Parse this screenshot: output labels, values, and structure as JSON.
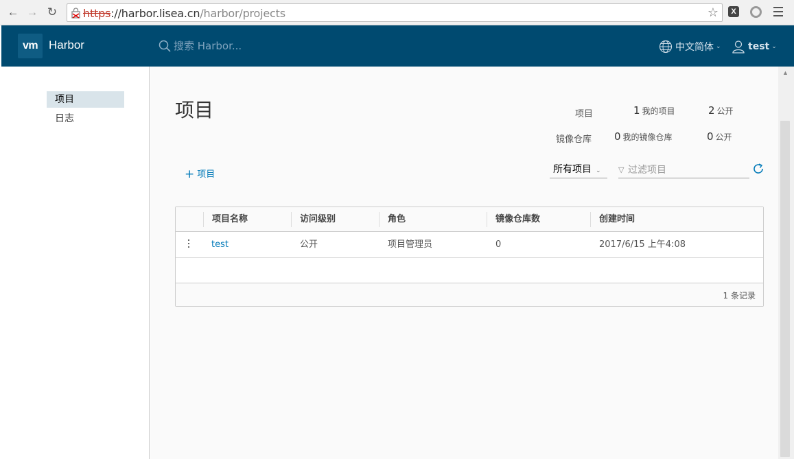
{
  "browser": {
    "url_scheme": "https",
    "url_sep": "://",
    "url_host": "harbor.lisea.cn",
    "url_path": "/harbor/projects"
  },
  "header": {
    "logo": "vm",
    "brand": "Harbor",
    "search_placeholder": "搜索 Harbor...",
    "language": "中文简体",
    "user": "test"
  },
  "sidebar": {
    "items": [
      {
        "label": "项目",
        "active": true
      },
      {
        "label": "日志",
        "active": false
      }
    ]
  },
  "main": {
    "title": "项目",
    "stats": {
      "projects_label": "项目",
      "my_projects_count": "1",
      "my_projects_label": "我的项目",
      "public_projects_count": "2",
      "public_projects_label": "公开",
      "repos_label": "镜像仓库",
      "my_repos_count": "0",
      "my_repos_label": "我的镜像仓库",
      "public_repos_count": "0",
      "public_repos_label": "公开"
    },
    "add_button": "项目",
    "filter_select": "所有项目",
    "filter_placeholder": "过滤项目",
    "table": {
      "columns": [
        "项目名称",
        "访问级别",
        "角色",
        "镜像仓库数",
        "创建时间"
      ],
      "rows": [
        {
          "name": "test",
          "access": "公开",
          "role": "项目管理员",
          "repo_count": "0",
          "created": "2017/6/15 上午4:08"
        }
      ],
      "footer": "1 条记录"
    }
  }
}
